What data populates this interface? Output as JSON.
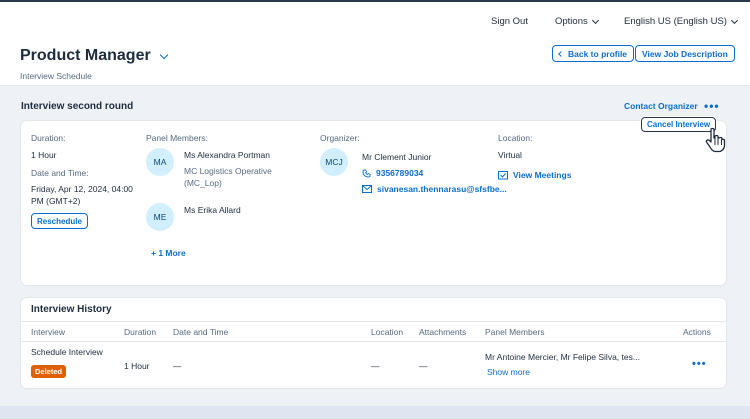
{
  "topbar": {
    "sign_out": "Sign Out",
    "options": "Options",
    "language": "English US (English US)"
  },
  "header": {
    "title": "Product Manager",
    "subtitle": "Interview Schedule",
    "back_label": "Back to profile",
    "view_job_label": "View Job Description"
  },
  "interview": {
    "title": "Interview second round",
    "contact_organizer": "Contact Organizer",
    "more": "•••",
    "cancel_label": "Cancel Interview",
    "duration_label": "Duration:",
    "duration_value": "1 Hour",
    "datetime_label": "Date and Time:",
    "datetime_value_line1": "Friday, Apr 12, 2024, 04:00",
    "datetime_value_line2": "PM (GMT+2)",
    "reschedule_label": "Reschedule",
    "panel_label": "Panel Members:",
    "panel": [
      {
        "initials": "MA",
        "name": "Ms Alexandra Portman",
        "role_line1": "MC Logistics Operative",
        "role_line2": "(MC_Lop)"
      },
      {
        "initials": "ME",
        "name": "Ms Erika Allard"
      }
    ],
    "more_members": "+ 1 More",
    "organizer_label": "Organizer:",
    "organizer": {
      "initials": "MCJ",
      "name": "Mr Clement Junior",
      "phone": "9356789034",
      "email": "sivanesan.thennarasu@sfsfbe..."
    },
    "location_label": "Location:",
    "location_value": "Virtual",
    "view_meetings": "View Meetings"
  },
  "history": {
    "title": "Interview History",
    "columns": [
      "Interview",
      "Duration",
      "Date and Time",
      "Location",
      "Attachments",
      "Panel Members",
      "Actions"
    ],
    "rows": [
      {
        "interview": "Schedule Interview",
        "status": "Deleted",
        "duration": "1 Hour",
        "datetime": "—",
        "location": "—",
        "attachments": "—",
        "panel": "Mr Antoine Mercier, Mr Felipe Silva, tes...",
        "show_more": "Show more",
        "actions": "•••"
      }
    ]
  }
}
